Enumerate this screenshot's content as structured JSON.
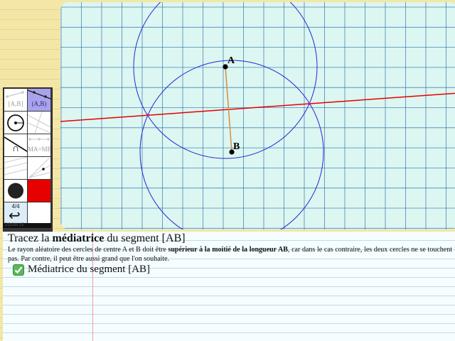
{
  "canvas": {
    "point_a": "A",
    "point_b": "B",
    "colors": {
      "background": "#dcf6f1",
      "grid": "#1e60a8",
      "circle": "#2626d6",
      "segment": "#d78c3c",
      "mediatrice": "#e60000"
    }
  },
  "toolbox": {
    "tools": [
      {
        "name": "segment-tool",
        "label": "[A,B]",
        "icon": "segment-icon"
      },
      {
        "name": "line-tool",
        "label": "(A,B)",
        "icon": "line-icon",
        "active": true
      },
      {
        "name": "circle-tool",
        "label": "",
        "icon": "circle-icon"
      },
      {
        "name": "perpendicular-tool",
        "label": "",
        "icon": "perpendicular-icon"
      },
      {
        "name": "intersection-tool",
        "label": "∩",
        "icon": "intersection-icon"
      },
      {
        "name": "midpoint-tool",
        "label": "MA=MB",
        "icon": "midpoint-icon"
      },
      {
        "name": "parallel-tool",
        "label": "",
        "icon": "parallel-icon"
      },
      {
        "name": "bisector-tool",
        "label": "",
        "icon": "bisector-icon"
      },
      {
        "name": "point-size-tool",
        "label": "",
        "icon": "filled-circle-icon"
      },
      {
        "name": "color-red-tool",
        "label": "",
        "icon": "color-swatch-icon"
      },
      {
        "name": "page-undo-tool",
        "label": "4/4",
        "icon": "undo-icon"
      },
      {
        "name": "color-white-tool",
        "label": "",
        "icon": "color-swatch-icon"
      }
    ],
    "footer": "ZOOM 15"
  },
  "exercise": {
    "title_prefix": "Tracez la ",
    "title_bold": "médiatrice",
    "title_suffix": " du segment [AB]",
    "desc_part1": "Le rayon aléatoire des cercles de centre A et B doit être ",
    "desc_bold": "supérieur à la moitié de la longueur AB",
    "desc_part2": ", car dans le cas contraire, les deux cercles ne se touchent pas. Par contre, il peut être aussi grand que l'on souhaite.",
    "task_label": "Médiatrice du segment [AB]",
    "task_done": true
  }
}
